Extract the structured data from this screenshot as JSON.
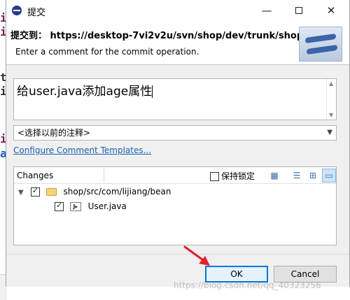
{
  "window": {
    "title": "提交",
    "minimize_label": "—",
    "close_label": "✕"
  },
  "header": {
    "title": "提交到： https://desktop-7vi2v2u/svn/shop/dev/trunk/shop",
    "message": "Enter a comment for the commit operation."
  },
  "comment": {
    "value": "给user.java添加age属性"
  },
  "history": {
    "selected": "<选择以前的注释>"
  },
  "link": {
    "label": "Configure Comment Templates..."
  },
  "changes": {
    "label": "Changes",
    "keep_lock_label": "保持锁定",
    "keep_lock_checked": false,
    "tree": [
      {
        "label": "shop/src/com/lijiang/bean",
        "checked": true,
        "expanded": true,
        "icon": "folder-icon"
      },
      {
        "label": "User.java",
        "checked": true,
        "icon": "java-file-icon"
      }
    ]
  },
  "buttons": {
    "ok": "OK",
    "cancel": "Cancel"
  },
  "watermark": "https://blog.csdn.net/qq_40323256",
  "colors": {
    "accent": "#0078d7",
    "link": "#1a5fb4",
    "annotation_arrow": "#e0202a"
  }
}
